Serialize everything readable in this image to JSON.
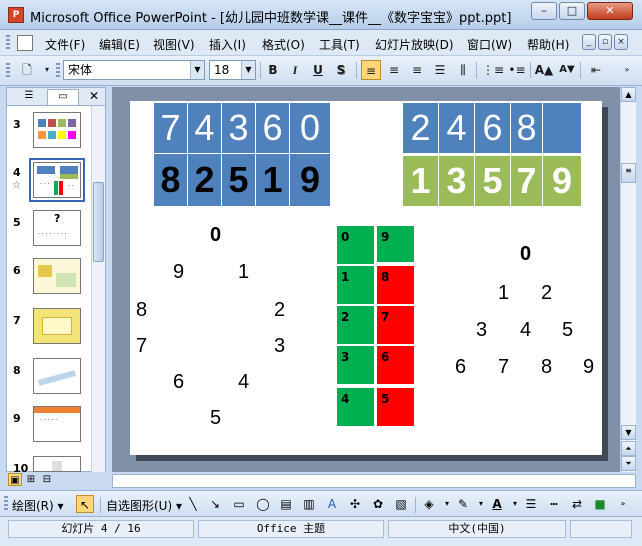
{
  "window": {
    "title": "Microsoft Office PowerPoint - [幼儿园中班数学课__课件__《数字宝宝》ppt.ppt]",
    "app_icon_label": "P"
  },
  "menu": {
    "items": [
      "文件(F)",
      "编辑(E)",
      "视图(V)",
      "插入(I)",
      "格式(O)",
      "工具(T)",
      "幻灯片放映(D)",
      "窗口(W)",
      "帮助(H)"
    ]
  },
  "toolbar": {
    "font_name": "宋体",
    "font_size": "18",
    "bold": "B",
    "italic": "I",
    "underline": "U",
    "shadow": "S"
  },
  "left_panel": {
    "tabs": [
      "outline",
      "slides"
    ],
    "thumbnails": [
      {
        "num": "3",
        "star": ""
      },
      {
        "num": "4",
        "star": "☆"
      },
      {
        "num": "5",
        "star": ""
      },
      {
        "num": "6",
        "star": ""
      },
      {
        "num": "7",
        "star": ""
      },
      {
        "num": "8",
        "star": ""
      },
      {
        "num": "9",
        "star": ""
      },
      {
        "num": "10",
        "star": ""
      }
    ],
    "thumb5_text": "?"
  },
  "slide": {
    "top_left_row1": [
      "7",
      "4",
      "3",
      "6",
      "0"
    ],
    "top_left_row2": [
      "8",
      "2",
      "5",
      "1",
      "9"
    ],
    "top_right_row1": [
      "2",
      "4",
      "6",
      "8",
      ""
    ],
    "top_right_row2": [
      "1",
      "3",
      "5",
      "7",
      "9"
    ],
    "circle_numbers": [
      "0",
      "9",
      "1",
      "8",
      "2",
      "7",
      "3",
      "6",
      "4",
      "5"
    ],
    "green_column": [
      "0",
      "1",
      "2",
      "3",
      "4"
    ],
    "red_column": [
      "9",
      "8",
      "7",
      "6",
      "5"
    ],
    "pyramid": [
      "0",
      "1",
      "2",
      "3",
      "4",
      "5",
      "6",
      "7",
      "8",
      "9"
    ],
    "colors": {
      "blue": "#4f81bd",
      "green": "#9bbb59",
      "green_cell": "#00b050",
      "red_cell": "#ff0000"
    }
  },
  "drawing_toolbar": {
    "draw_label": "绘图(R)",
    "autoshapes_label": "自选图形(U)"
  },
  "status": {
    "slide": "幻灯片 4 / 16",
    "theme": "Office 主题",
    "language": "中文(中国)"
  }
}
